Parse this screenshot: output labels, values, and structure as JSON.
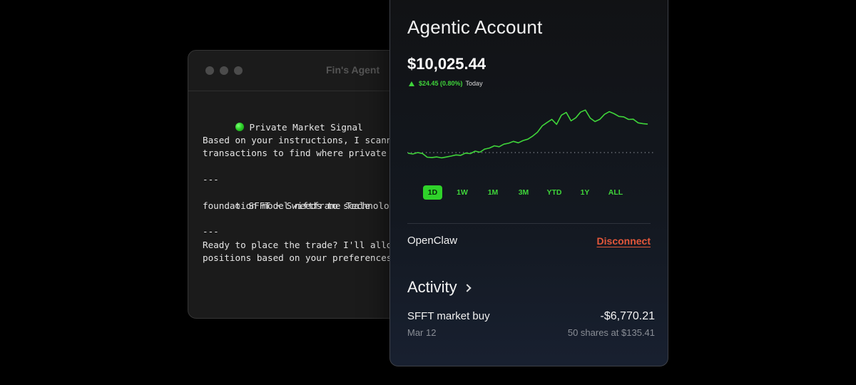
{
  "terminal": {
    "title": "Fin's Agent",
    "lines": {
      "signal": "Private Market Signal",
      "instr1": "Based on your instructions, I scann",
      "instr2": "transactions to find where private",
      "sep1": "---",
      "company1": "SFFT · Swiftframe Technologies ·",
      "company2": "foundation model needs to scale",
      "sep2": "---",
      "ready1": "Ready to place the trade? I'll allo",
      "ready2": "positions based on your preferences"
    },
    "icons": {
      "signal": "green-circle-icon",
      "company": "gear-icon"
    }
  },
  "account": {
    "title": "Agentic Account",
    "balance": "$10,025.44",
    "change": "$24.45 (0.80%)",
    "change_period": "Today",
    "ranges": [
      "1D",
      "1W",
      "1M",
      "3M",
      "YTD",
      "1Y",
      "ALL"
    ],
    "active_range": "1D",
    "connection": "OpenClaw",
    "disconnect_label": "Disconnect",
    "activity_title": "Activity",
    "activity": [
      {
        "description": "SFFT market buy",
        "amount": "-$6,770.21",
        "date": "Mar 12",
        "detail": "50 shares at $135.41"
      }
    ]
  },
  "colors": {
    "accent_green": "#3fd43a",
    "disconnect_red": "#e4573a",
    "background": "#000000"
  },
  "chart_data": {
    "type": "line",
    "x": [
      0,
      2,
      4,
      6,
      8,
      10,
      12,
      14,
      16,
      18,
      20,
      22,
      24,
      26,
      28,
      30,
      32,
      34,
      36,
      38,
      40,
      42,
      44,
      46,
      48,
      50,
      52,
      54,
      56,
      58,
      60,
      62,
      64,
      66,
      68,
      70,
      72,
      74,
      76,
      78,
      80,
      82,
      84,
      86,
      88,
      90,
      92,
      94,
      96,
      98,
      100
    ],
    "y": [
      10000.5,
      9999.8,
      10001.0,
      10000.2,
      9997.0,
      9996.8,
      9997.3,
      9996.5,
      9997.2,
      9998.0,
      9999.0,
      9998.6,
      10000.6,
      10000.1,
      10002.2,
      10001.3,
      10004.0,
      10004.9,
      10006.8,
      10006.0,
      10008.2,
      10009.0,
      10010.6,
      10009.4,
      10011.3,
      10012.5,
      10015.1,
      10018.4,
      10023.9,
      10026.8,
      10029.5,
      10025.2,
      10033.0,
      10035.4,
      10028.2,
      10030.8,
      10035.7,
      10037.5,
      10030.6,
      10027.6,
      10029.5,
      10033.8,
      10036.1,
      10034.3,
      10032.0,
      10031.6,
      10029.4,
      10029.6,
      10026.5,
      10025.8,
      10025.4
    ],
    "baseline": 10000.99,
    "ylim": [
      9990,
      10045
    ],
    "grid": false
  }
}
